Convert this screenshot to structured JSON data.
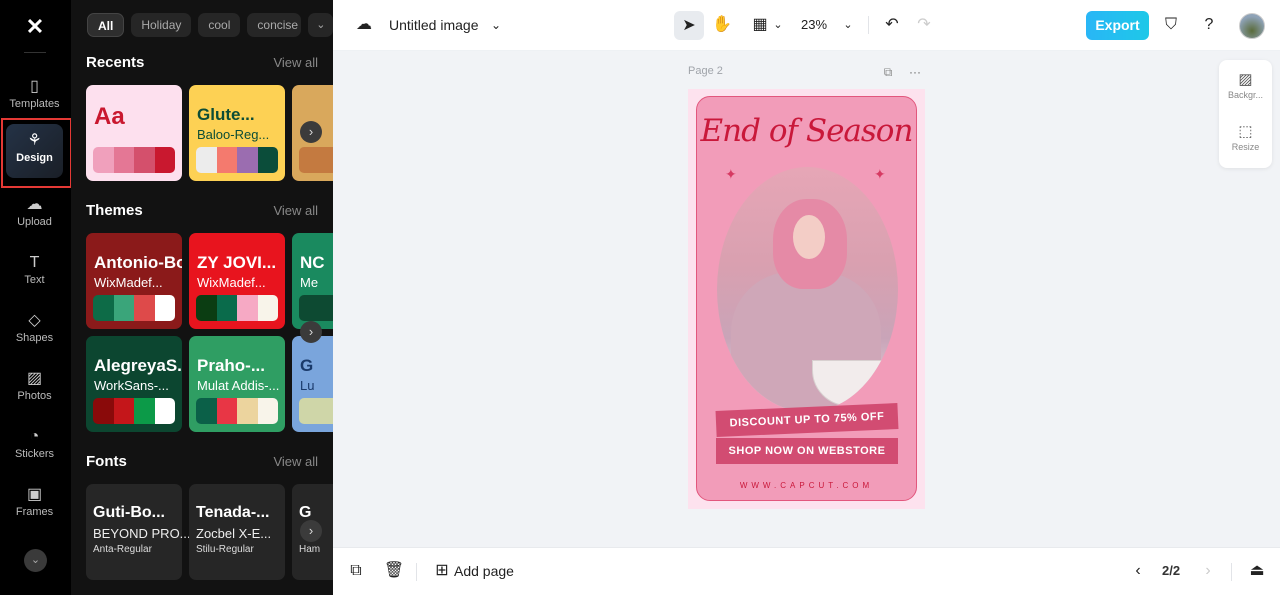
{
  "app": {
    "logo": "capcut-logo"
  },
  "rail": {
    "items": [
      {
        "label": "Templates",
        "icon": "templates-icon",
        "glyph": "▯"
      },
      {
        "label": "Design",
        "icon": "design-icon",
        "glyph": "⚘",
        "active": true
      },
      {
        "label": "Upload",
        "icon": "upload-cloud-icon",
        "glyph": "☁"
      },
      {
        "label": "Text",
        "icon": "text-icon",
        "glyph": "T"
      },
      {
        "label": "Shapes",
        "icon": "shapes-icon",
        "glyph": "◇"
      },
      {
        "label": "Photos",
        "icon": "photos-icon",
        "glyph": "▨"
      },
      {
        "label": "Stickers",
        "icon": "stickers-icon",
        "glyph": "◔"
      },
      {
        "label": "Frames",
        "icon": "frames-icon",
        "glyph": "▣"
      }
    ],
    "more_glyph": "⌄"
  },
  "panel": {
    "chips": [
      "All",
      "Holiday",
      "cool",
      "concise"
    ],
    "chip_more_glyph": "⌄",
    "recents": {
      "title": "Recents",
      "view_all": "View all",
      "cards": [
        {
          "t1": "Aa",
          "t2": "",
          "bg": "#fde0ee",
          "color": "#c9182f",
          "swatches": [
            "#f0a0bc",
            "#e47795",
            "#d4506c",
            "#c9182f"
          ]
        },
        {
          "t1": "Glute...",
          "t2": "Baloo-Reg...",
          "bg": "#fdd154",
          "color": "#0c4d36",
          "swatches": [
            "#ececec",
            "#f47a6e",
            "#9b6db0",
            "#0b4d3a"
          ]
        },
        {
          "t1": "",
          "t2": "",
          "bg": "#d9a85c",
          "color": "#fff",
          "swatches": [
            "#c47a40"
          ]
        }
      ]
    },
    "themes": {
      "title": "Themes",
      "view_all": "View all",
      "cards": [
        {
          "t1": "Antonio-Bold",
          "t2": "WixMadef...",
          "bg": "#8b1a1a",
          "color": "#fff",
          "swatches": [
            "#0d6b47",
            "#3aa57a",
            "#de4a4a",
            "#ffffff"
          ]
        },
        {
          "t1": "ZY JOVI...",
          "t2": "WixMadef...",
          "bg": "#e8141e",
          "color": "#fff",
          "swatches": [
            "#0b3d12",
            "#0a6b4b",
            "#f6a9c4",
            "#f8f4ea"
          ]
        },
        {
          "t1": "NC",
          "t2": "Me",
          "bg": "#1a8a5f",
          "color": "#fff",
          "swatches": [
            "#0d4a32"
          ]
        },
        {
          "t1": "AlegreyaS...",
          "t2": "WorkSans-...",
          "bg": "#0c4630",
          "color": "#fff",
          "swatches": [
            "#8a0a0a",
            "#c4161a",
            "#0c9a48",
            "#ffffff"
          ]
        },
        {
          "t1": "Praho-...",
          "t2": "Mulat Addis-...",
          "bg": "#2f9e63",
          "color": "#fff",
          "swatches": [
            "#0b6048",
            "#e83645",
            "#ecd49e",
            "#f8f4ea"
          ]
        },
        {
          "t1": "G",
          "t2": "Lu",
          "bg": "#7aa5dc",
          "color": "#1a3a6a",
          "swatches": [
            "#cfd6a8"
          ]
        }
      ]
    },
    "fonts": {
      "title": "Fonts",
      "view_all": "View all",
      "cards": [
        {
          "f1": "Guti-Bo...",
          "f2": "BEYOND PRO...",
          "f3": "Anta-Regular"
        },
        {
          "f1": "Tenada-...",
          "f2": "Zocbel X-E...",
          "f3": "Stilu-Regular"
        },
        {
          "f1": "G",
          "f2": "",
          "f3": "Ham"
        }
      ]
    },
    "next_glyph": "›",
    "collapse_glyph": "‹"
  },
  "topbar": {
    "doc_title": "Untitled image",
    "zoom": "23%",
    "export_label": "Export"
  },
  "canvas": {
    "page_label": "Page 2",
    "poster": {
      "title": "End of Season",
      "banner1": "DISCOUNT UP TO 75% OFF",
      "banner2": "SHOP NOW ON WEBSTORE",
      "url": "WWW.CAPCUT.COM"
    },
    "side_tools": [
      {
        "label": "Backgr...",
        "icon": "background-icon",
        "glyph": "▨"
      },
      {
        "label": "Resize",
        "icon": "resize-icon",
        "glyph": "⬚"
      }
    ]
  },
  "bottombar": {
    "add_page": "Add page",
    "page_indicator": "2/2"
  }
}
